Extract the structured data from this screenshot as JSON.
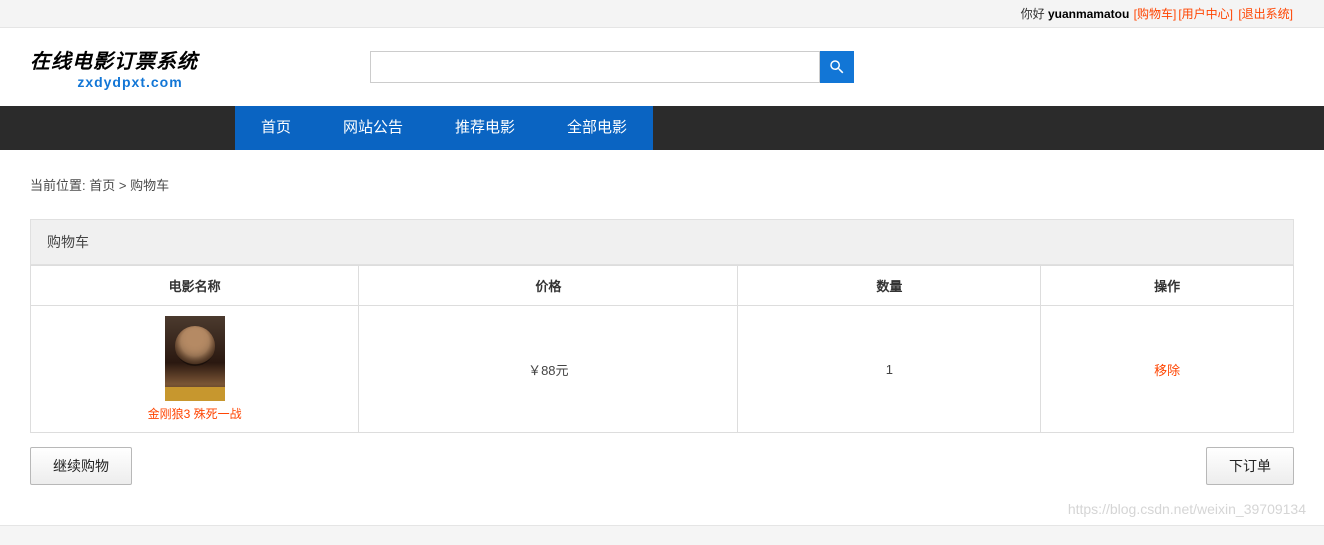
{
  "topbar": {
    "greeting": "你好",
    "username": "yuanmamatou",
    "links": {
      "cart": "[购物车]",
      "user_center": "[用户中心]",
      "logout": "[退出系统]"
    }
  },
  "logo": {
    "title_text": "在线电影订票系统",
    "domain": "zxdydpxt.com"
  },
  "search": {
    "placeholder": ""
  },
  "nav": {
    "items": [
      "首页",
      "网站公告",
      "推荐电影",
      "全部电影"
    ]
  },
  "breadcrumb": {
    "label": "当前位置:",
    "home": "首页",
    "sep": ">",
    "current": "购物车"
  },
  "cart": {
    "title": "购物车",
    "headers": {
      "name": "电影名称",
      "price": "价格",
      "qty": "数量",
      "action": "操作"
    },
    "rows": [
      {
        "movie_name": "金刚狼3 殊死一战",
        "price": "￥88元",
        "qty": "1",
        "action": "移除"
      }
    ]
  },
  "buttons": {
    "continue": "继续购物",
    "order": "下订单"
  },
  "watermark": "https://blog.csdn.net/weixin_39709134"
}
